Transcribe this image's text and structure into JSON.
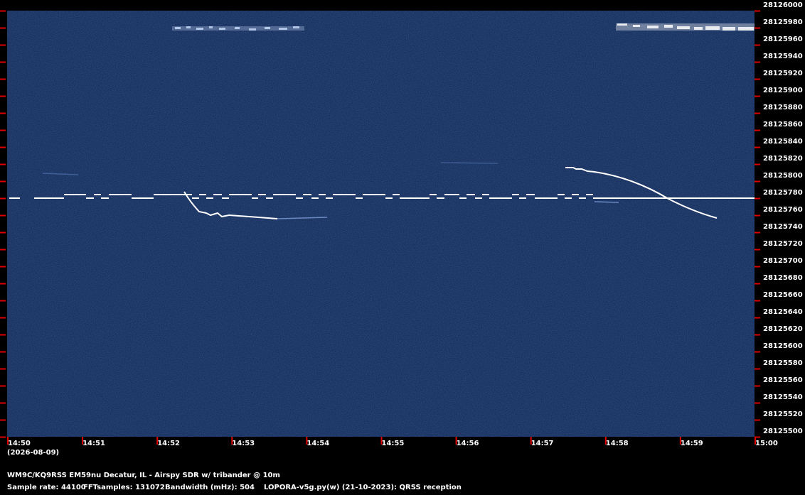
{
  "colors": {
    "background": "#000000",
    "waterfall": "#0d2452",
    "tick": "#e00000",
    "signal": "#ffffff",
    "text": "#ffffff"
  },
  "freq_axis": {
    "min": 28125500,
    "max": 28126000,
    "labels": [
      "28126000",
      "28125980",
      "28125960",
      "28125940",
      "28125920",
      "28125900",
      "28125880",
      "28125860",
      "28125840",
      "28125820",
      "28125800",
      "28125780",
      "28125760",
      "28125740",
      "28125720",
      "28125700",
      "28125680",
      "28125660",
      "28125640",
      "28125620",
      "28125600",
      "28125580",
      "28125560",
      "28125540",
      "28125520",
      "28125500"
    ]
  },
  "time_axis": {
    "labels": [
      "14:50",
      "14:51",
      "14:52",
      "14:53",
      "14:54",
      "14:55",
      "14:56",
      "14:57",
      "14:58",
      "14:59",
      "15:00"
    ],
    "date": "(2026-08-09)"
  },
  "info": {
    "station": "WM9C/KQ9RSS EM59nu Decatur, IL - Airspy SDR w/ tribander @ 10m",
    "sample_rate": "Sample rate: 44100",
    "fft_samples": "FFTsamples: 131072",
    "bandwidth": "Bandwidth (mHz): 504",
    "software": "LOPORA-v5g.py(w) (21-10-2023): QRSS reception"
  }
}
